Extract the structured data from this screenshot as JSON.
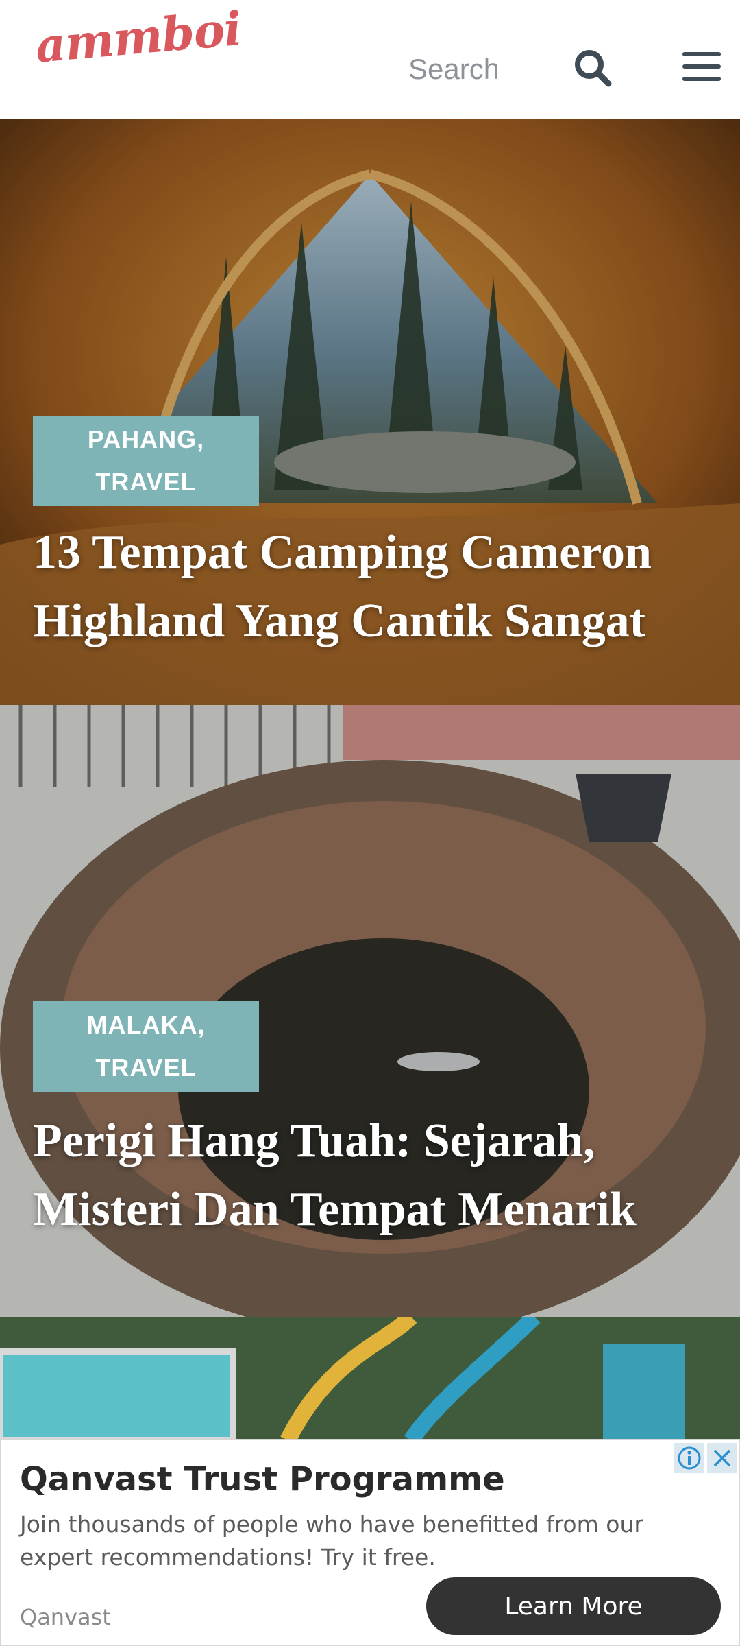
{
  "header": {
    "logo_text": "ammboi",
    "search_placeholder": "Search",
    "icons": {
      "search": "search-icon",
      "menu": "hamburger-menu-icon"
    }
  },
  "posts": [
    {
      "categories": [
        "PAHANG,",
        "TRAVEL"
      ],
      "title": "13 Tempat Camping Cameron Highland Yang Cantik Sangat",
      "image": "tent-view-forest-campsite"
    },
    {
      "categories": [
        "MALAKA,",
        "TRAVEL"
      ],
      "title": "Perigi Hang Tuah: Sejarah, Misteri Dan Tempat Menarik",
      "image": "stone-well"
    },
    {
      "image": "waterpark-aerial"
    }
  ],
  "ad": {
    "title": "Qanvast Trust Programme",
    "body": "Join thousands of people who have benefitted from our expert recommendations! Try it free.",
    "brand": "Qanvast",
    "cta": "Learn More",
    "icons": {
      "info": "info-icon",
      "close": "close-icon"
    }
  },
  "colors": {
    "brand": "#d9585e",
    "badge": "#7eb4b6",
    "cta_bg": "#333333",
    "icon": "#3f4b55"
  }
}
